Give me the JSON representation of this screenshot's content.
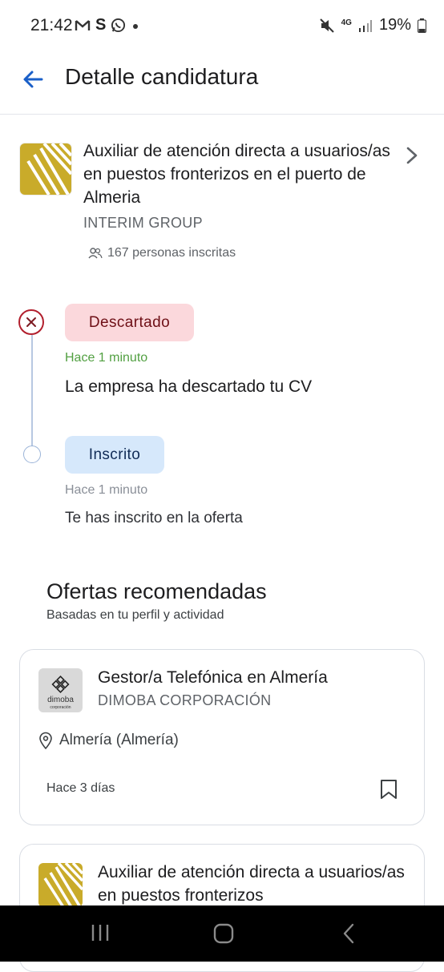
{
  "status_bar": {
    "time": "21:42",
    "left_icons": [
      "gmail-icon",
      "s-icon",
      "whatsapp-icon",
      "dot-icon"
    ],
    "network": "4G",
    "battery": "19%"
  },
  "header": {
    "title": "Detalle candidatura"
  },
  "job": {
    "title": "Auxiliar de atención directa a usuarios/as en puestos fronterizos en el puerto de Almeria",
    "company": "INTERIM GROUP",
    "applicants": "167 personas inscritas"
  },
  "timeline": [
    {
      "status": "Descartado",
      "time": "Hace 1 minuto",
      "text": "La empresa ha descartado tu CV"
    },
    {
      "status": "Inscrito",
      "time": "Hace 1 minuto",
      "text": "Te has inscrito en la oferta"
    }
  ],
  "recommendations": {
    "title": "Ofertas recomendadas",
    "subtitle": "Basadas en tu perfil y actividad",
    "cards": [
      {
        "title": "Gestor/a Telefónica en Almería",
        "company": "DIMOBA CORPORACIÓN",
        "logo_text": "dimoba",
        "logo_subtext": "corporación",
        "location": "Almería (Almería)",
        "date": "Hace 3 días"
      },
      {
        "title": "Auxiliar de atención directa a usuarios/as en puestos fronterizos"
      }
    ]
  },
  "colors": {
    "accent": "#1a5fc8",
    "discarded_bg": "#fbd8dc",
    "enrolled_bg": "#d6e8fb",
    "recent_green": "#52a042"
  }
}
